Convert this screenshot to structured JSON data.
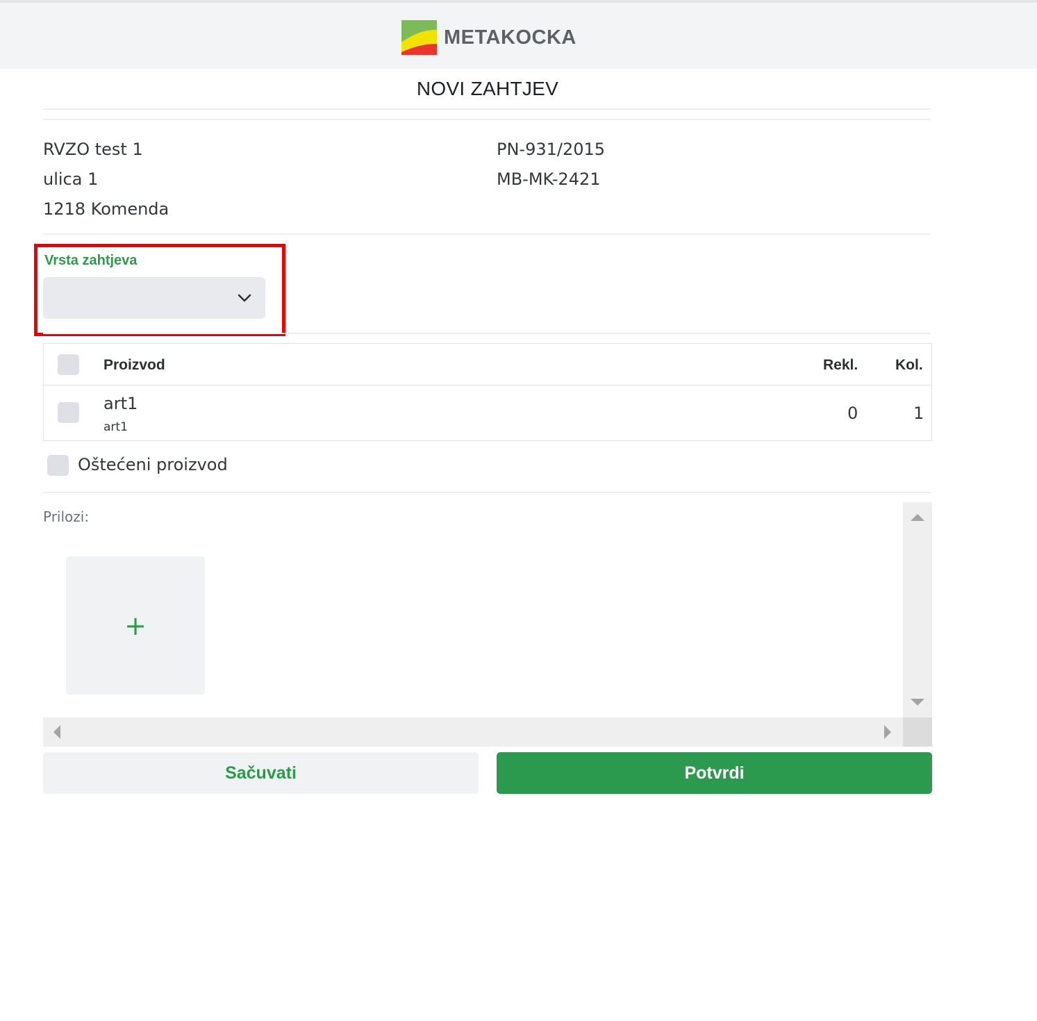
{
  "header": {
    "logo_text": "METAKOCKA"
  },
  "page": {
    "title": "NOVI ZAHTJEV"
  },
  "customer": {
    "name": "RVZO test 1",
    "street": "ulica 1",
    "city": "1218 Komenda"
  },
  "document": {
    "number": "PN-931/2015",
    "code": "MB-MK-2421"
  },
  "request_type": {
    "label": "Vrsta zahtjeva",
    "selected": ""
  },
  "table": {
    "headers": {
      "product": "Proizvod",
      "claimed": "Rekl.",
      "quantity": "Kol."
    },
    "rows": [
      {
        "name": "art1",
        "code": "art1",
        "claimed": "0",
        "quantity": "1"
      }
    ]
  },
  "damaged": {
    "label": "Oštećeni proizvod"
  },
  "attachments": {
    "label": "Prilozi:",
    "add_symbol": "+"
  },
  "buttons": {
    "save": "Sačuvati",
    "confirm": "Potvrdi"
  },
  "colors": {
    "accent_green": "#2c9a4e",
    "highlight_red": "#ee0000"
  },
  "icons": {
    "select_arrow": "chevron-down-icon",
    "add": "plus-icon"
  }
}
